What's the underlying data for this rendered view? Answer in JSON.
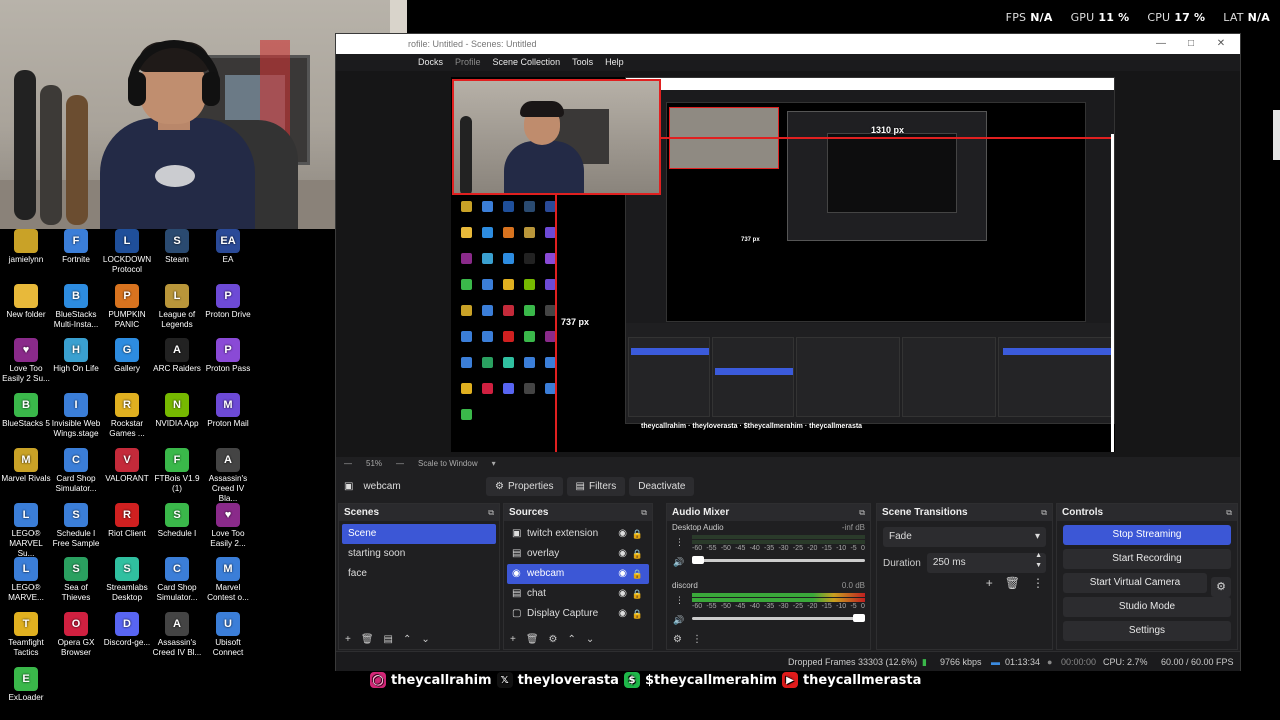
{
  "stats": [
    {
      "label": "FPS",
      "value": "N/A"
    },
    {
      "label": "GPU",
      "value": "11 %"
    },
    {
      "label": "CPU",
      "value": "17 %"
    },
    {
      "label": "LAT",
      "value": "N/A"
    }
  ],
  "desktop_icons": [
    {
      "label": "jamielynn",
      "color": "#c9a227",
      "glyph": ""
    },
    {
      "label": "Fortnite",
      "color": "#3b7ed8",
      "glyph": "F"
    },
    {
      "label": "LOCKDOWN Protocol",
      "color": "#1f4f9a",
      "glyph": "L"
    },
    {
      "label": "Steam",
      "color": "#2a4a70",
      "glyph": "S"
    },
    {
      "label": "EA",
      "color": "#2a4a98",
      "glyph": "EA"
    },
    {
      "label": "New folder",
      "color": "#e8b93a",
      "glyph": ""
    },
    {
      "label": "BlueStacks Multi-Insta...",
      "color": "#2d8ce0",
      "glyph": "B"
    },
    {
      "label": "PUMPKIN PANIC",
      "color": "#d8731f",
      "glyph": "P"
    },
    {
      "label": "League of Legends",
      "color": "#b9963a",
      "glyph": "L"
    },
    {
      "label": "Proton Drive",
      "color": "#6d4ad6",
      "glyph": "P"
    },
    {
      "label": "Love Too Easily 2 Su...",
      "color": "#8a2a8a",
      "glyph": "♥"
    },
    {
      "label": "High On Life",
      "color": "#3aa0d0",
      "glyph": "H"
    },
    {
      "label": "Gallery",
      "color": "#2d8ce0",
      "glyph": "G"
    },
    {
      "label": "ARC Raiders",
      "color": "#222",
      "glyph": "A"
    },
    {
      "label": "Proton Pass",
      "color": "#8a4ad6",
      "glyph": "P"
    },
    {
      "label": "BlueStacks 5",
      "color": "#3ab84a",
      "glyph": "B"
    },
    {
      "label": "Invisible Web Wings.stage",
      "color": "#3b7ed8",
      "glyph": "I"
    },
    {
      "label": "Rockstar Games ...",
      "color": "#e0b020",
      "glyph": "R"
    },
    {
      "label": "NVIDIA App",
      "color": "#76b900",
      "glyph": "N"
    },
    {
      "label": "Proton Mail",
      "color": "#6d4ad6",
      "glyph": "M"
    },
    {
      "label": "Marvel Rivals",
      "color": "#c9a227",
      "glyph": "M"
    },
    {
      "label": "Card Shop Simulator...",
      "color": "#3b7ed8",
      "glyph": "C"
    },
    {
      "label": "VALORANT",
      "color": "#c42a3a",
      "glyph": "V"
    },
    {
      "label": "FTBois V1.9 (1)",
      "color": "#3ab84a",
      "glyph": "F"
    },
    {
      "label": "Assassin's Creed IV Bla...",
      "color": "#444",
      "glyph": "A"
    },
    {
      "label": "LEGO® MARVEL Su...",
      "color": "#3b7ed8",
      "glyph": "L"
    },
    {
      "label": "Schedule I Free Sample",
      "color": "#3b7ed8",
      "glyph": "S"
    },
    {
      "label": "Riot Client",
      "color": "#d02020",
      "glyph": "R"
    },
    {
      "label": "Schedule I",
      "color": "#3ab84a",
      "glyph": "S"
    },
    {
      "label": "Love Too Easily 2...",
      "color": "#8a2a8a",
      "glyph": "♥"
    },
    {
      "label": "LEGO® MARVE...",
      "color": "#3b7ed8",
      "glyph": "L"
    },
    {
      "label": "Sea of Thieves",
      "color": "#2aa060",
      "glyph": "S"
    },
    {
      "label": "Streamlabs Desktop",
      "color": "#30c0a0",
      "glyph": "S"
    },
    {
      "label": "Card Shop Simulator...",
      "color": "#3b7ed8",
      "glyph": "C"
    },
    {
      "label": "Marvel Contest o...",
      "color": "#3b7ed8",
      "glyph": "M"
    },
    {
      "label": "Teamfight Tactics",
      "color": "#e0b020",
      "glyph": "T"
    },
    {
      "label": "Opera GX Browser",
      "color": "#d02040",
      "glyph": "O"
    },
    {
      "label": "Discord-ge...",
      "color": "#5865f2",
      "glyph": "D"
    },
    {
      "label": "Assassin's Creed IV Bl...",
      "color": "#444",
      "glyph": "A"
    },
    {
      "label": "Ubisoft Connect",
      "color": "#3b7ed8",
      "glyph": "U"
    },
    {
      "label": "ExLoader",
      "color": "#3ab84a",
      "glyph": "E"
    }
  ],
  "obs": {
    "title": "rofile: Untitled - Scenes: Untitled",
    "menu": [
      "Docks",
      "Profile",
      "Scene Collection",
      "Tools",
      "Help"
    ],
    "px_label_1": "1310 px",
    "px_label_2": "737 px",
    "px_label_3": "737 px",
    "preview_zoom": "51%",
    "preview_scale": "Scale to Window",
    "selected_source": "webcam",
    "toolbar": {
      "properties": "Properties",
      "filters": "Filters",
      "deactivate": "Deactivate"
    },
    "scenes": {
      "title": "Scenes",
      "items": [
        "Scene",
        "starting soon",
        "face"
      ],
      "selected": 0
    },
    "sources": {
      "title": "Sources",
      "items": [
        "twitch extension",
        "overlay",
        "webcam",
        "chat",
        "Display Capture"
      ],
      "selected": 2
    },
    "mixer": {
      "title": "Audio Mixer",
      "channels": [
        {
          "name": "Desktop Audio",
          "db": "-inf dB",
          "level": 0.0
        },
        {
          "name": "discord",
          "db": "0.0 dB",
          "level": 1.0
        }
      ],
      "scale": [
        "-60",
        "-55",
        "-50",
        "-45",
        "-40",
        "-35",
        "-30",
        "-25",
        "-20",
        "-15",
        "-10",
        "-5",
        "0"
      ]
    },
    "transitions": {
      "title": "Scene Transitions",
      "type": "Fade",
      "duration_label": "Duration",
      "duration": "250 ms"
    },
    "controls": {
      "title": "Controls",
      "buttons": [
        "Stop Streaming",
        "Start Recording",
        "Start Virtual Camera",
        "Studio Mode",
        "Settings"
      ]
    },
    "status": {
      "dropped": "Dropped Frames 33303 (12.6%)",
      "kbps": "9766 kbps",
      "stream_time": "01:13:34",
      "rec_time": "00:00:00",
      "cpu": "CPU: 2.7%",
      "fps": "60.00 / 60.00 FPS"
    }
  },
  "socials": [
    {
      "icon": "instagram",
      "handle": "theycallrahim",
      "color": "#d6287a"
    },
    {
      "icon": "x",
      "handle": "theyloverasta",
      "color": "#111"
    },
    {
      "icon": "cashapp",
      "handle": "$theycallmerahim",
      "color": "#1fb84a"
    },
    {
      "icon": "youtube",
      "handle": "theycallmerasta",
      "color": "#e01b1b"
    }
  ]
}
